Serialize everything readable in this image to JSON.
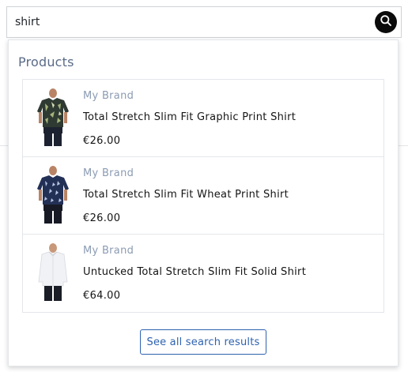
{
  "search": {
    "value": "shirt",
    "button_icon": "search-icon"
  },
  "results": {
    "section_title": "Products",
    "products": [
      {
        "brand": "My Brand",
        "name": "Total Stretch Slim Fit Graphic Print Shirt",
        "price": "€26.00"
      },
      {
        "brand": "My Brand",
        "name": "Total Stretch Slim Fit Wheat Print Shirt",
        "price": "€26.00"
      },
      {
        "brand": "My Brand",
        "name": "Untucked Total Stretch Slim Fit Solid Shirt",
        "price": "€64.00"
      }
    ],
    "see_all_label": "See all search results"
  },
  "colors": {
    "accent": "#2e62b0",
    "brand_text": "#8b9bb3",
    "section_title": "#5a6b86",
    "search_button": "#0b0b0b"
  }
}
